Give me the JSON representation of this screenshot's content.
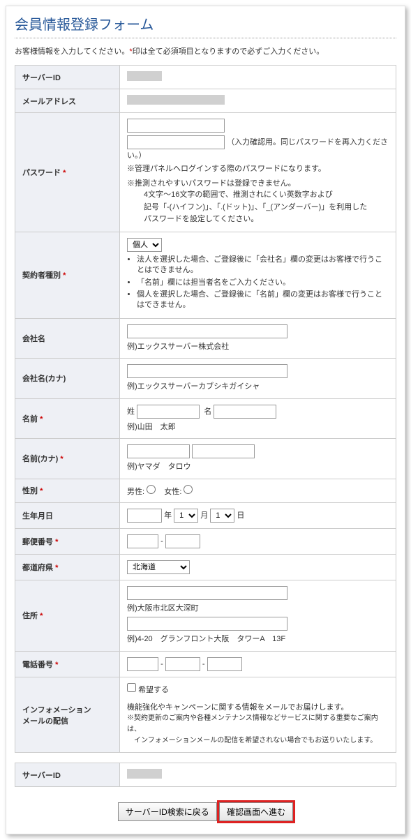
{
  "title": "会員情報登録フォーム",
  "intro_a": "お客様情報を入力してください。",
  "intro_b": "印は全て必須項目となりますので必ずご入力ください。",
  "rows": {
    "server_id": "サーバーID",
    "email": "メールアドレス",
    "password": "パスワード",
    "contract_type": "契約者種別",
    "company": "会社名",
    "company_kana": "会社名(カナ)",
    "name": "名前",
    "name_kana": "名前(カナ)",
    "gender": "性別",
    "birth": "生年月日",
    "postal": "郵便番号",
    "pref": "都道府県",
    "address": "住所",
    "phone": "電話番号",
    "info_mail_l1": "インフォメーション",
    "info_mail_l2": "メールの配信"
  },
  "password": {
    "confirm_note": "（入力確認用。同じパスワードを再入力ください。）",
    "note1": "※管理パネルへログインする際のパスワードになります。",
    "note2": "※推測されやすいパスワードは登録できません。",
    "note3": "4文字～16文字の範囲で、推測されにくい英数字および",
    "note4": "記号「-(ハイフン)」、「.(ドット)」、「_(アンダーバー)」を利用した",
    "note5": "パスワードを設定してください。"
  },
  "contract": {
    "select_default": "個人",
    "li1": "法人を選択した場合、ご登録後に「会社名」欄の変更はお客様で行うことはできません。",
    "li2": "「名前」欄には担当者名をご入力ください。",
    "li3": "個人を選択した場合、ご登録後に「名前」欄の変更はお客様で行うことはできません。"
  },
  "company_ex": "例)エックスサーバー株式会社",
  "company_kana_ex": "例)エックスサーバーカブシキガイシャ",
  "name_labels": {
    "sei": "姓",
    "mei": "名"
  },
  "name_ex": "例)山田　太郎",
  "name_kana_ex": "例)ヤマダ　タロウ",
  "gender": {
    "male": "男性:",
    "female": "女性:"
  },
  "birth": {
    "year": "年",
    "month": "月",
    "day": "日",
    "month_v": "1",
    "day_v": "1"
  },
  "sep": "-",
  "pref_default": "北海道",
  "addr1_ex": "例)大阪市北区大深町",
  "addr2_ex": "例)4-20　グランフロント大阪　タワーA　13F",
  "info_mail": {
    "opt": "希望する",
    "line1": "機能強化やキャンペーンに関する情報をメールでお届けします。",
    "line2": "※契約更新のご案内や各種メンテナンス情報などサービスに関する重要なご案内は、",
    "line3": "　インフォメーションメールの配信を希望されない場合でもお送りいたします。"
  },
  "server_id2": "サーバーID",
  "buttons": {
    "back": "サーバーID検索に戻る",
    "next": "確認画面へ進む"
  }
}
